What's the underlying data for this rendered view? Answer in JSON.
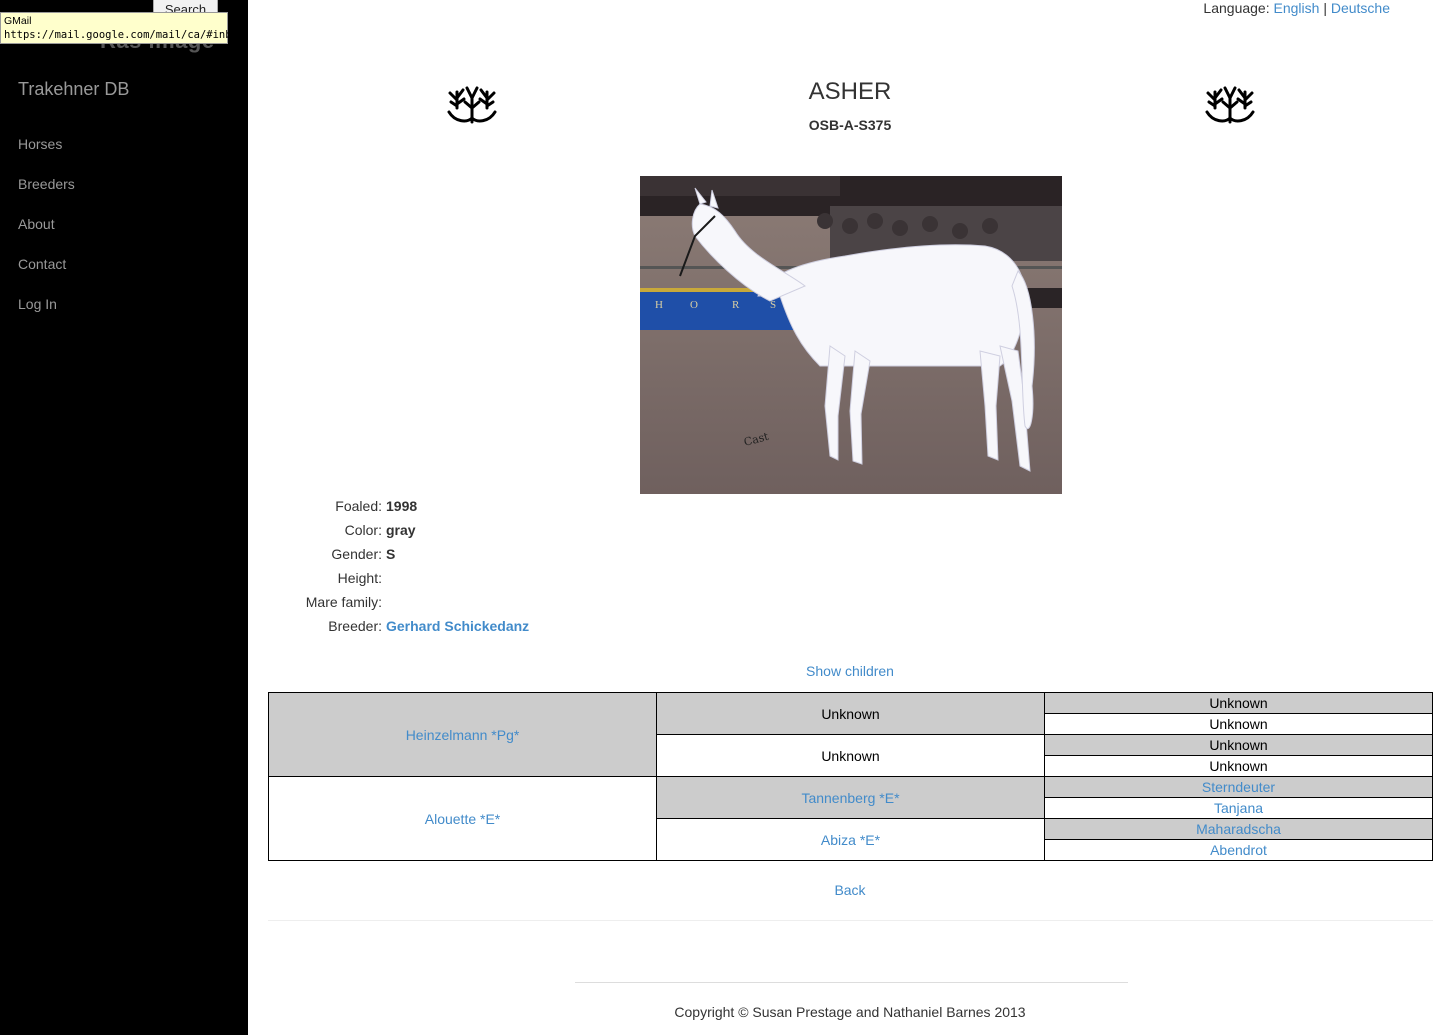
{
  "sidebar": {
    "search_button": "Search",
    "ghost_text": "Ras image",
    "tooltip": {
      "title": "GMail",
      "url": "https://mail.google.com/mail/ca/#inbox"
    },
    "brand": "Trakehner DB",
    "nav": [
      {
        "label": "Horses"
      },
      {
        "label": "Breeders"
      },
      {
        "label": "About"
      },
      {
        "label": "Contact"
      },
      {
        "label": "Log In"
      }
    ]
  },
  "language": {
    "label": "Language:",
    "english": "English",
    "separator": "|",
    "german": "Deutsche"
  },
  "horse": {
    "name": "ASHER",
    "registration": "OSB-A-S375",
    "details": [
      {
        "label": "Foaled:",
        "value": "1998",
        "link": false
      },
      {
        "label": "Color:",
        "value": "gray",
        "link": false
      },
      {
        "label": "Gender:",
        "value": "S",
        "link": false
      },
      {
        "label": "Height:",
        "value": "",
        "link": false
      },
      {
        "label": "Mare family:",
        "value": "",
        "link": false
      },
      {
        "label": "Breeder:",
        "value": "Gerhard Schickedanz",
        "link": true
      }
    ]
  },
  "show_children": "Show children",
  "pedigree": {
    "sire": "Heinzelmann *Pg*",
    "dam": "Alouette *E*",
    "sire_sire": "Unknown",
    "sire_dam": "Unknown",
    "dam_sire": "Tannenberg *E*",
    "dam_dam": "Abiza *E*",
    "ss_sire": "Unknown",
    "ss_dam": "Unknown",
    "sd_sire": "Unknown",
    "sd_dam": "Unknown",
    "ds_sire": "Sterndeuter",
    "ds_dam": "Tanjana",
    "dd_sire": "Maharadscha",
    "dd_dam": "Abendrot"
  },
  "back": "Back",
  "footer": "Copyright © Susan Prestage and Nathaniel Barnes 2013",
  "colors": {
    "link": "#428bca",
    "sidebar_bg": "#000000",
    "pedigree_gray": "#cccccc"
  },
  "icons": [
    "trakehner-antler-icon"
  ]
}
